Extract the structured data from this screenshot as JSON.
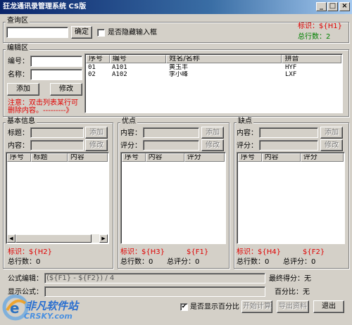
{
  "window": {
    "title": "狂龙通讯录管理系统 CS版",
    "btn_min": "_",
    "btn_max": "□",
    "btn_close": "×"
  },
  "query": {
    "group_label": "查询区",
    "input_value": "",
    "confirm_label": "确定",
    "hide_checkbox_label": "是否隐藏输入框",
    "hide_checked": false,
    "tag": "标识：${H1}",
    "count": "总行数：2"
  },
  "edit": {
    "group_label": "编辑区",
    "code_label": "编号：",
    "name_label": "名称：",
    "code_value": "",
    "name_value": "",
    "add_label": "添加",
    "modify_label": "修改",
    "note": "注意：双击列表某行可删除内容。---------》",
    "columns": [
      "序号",
      "编号",
      "姓名/名称",
      "拼音"
    ],
    "rows": [
      [
        "01",
        "A101",
        "黄玉丰",
        "HYF"
      ],
      [
        "02",
        "A102",
        "李小峰",
        "LXF"
      ]
    ]
  },
  "basic": {
    "group_label": "基本信息",
    "title_label": "标题：",
    "content_label": "内容：",
    "add_label": "添加",
    "modify_label": "修改",
    "columns": [
      "序号",
      "标题",
      "内容"
    ],
    "tag": "标识：${H2}",
    "count": "总行数：0"
  },
  "pros": {
    "group_label": "优点",
    "content_label": "内容：",
    "score_label": "评分：",
    "add_label": "添加",
    "modify_label": "修改",
    "columns": [
      "序号",
      "内容",
      "评分"
    ],
    "tag": "标识：${H3}",
    "formula_tag": "${F1}",
    "count": "总行数：0",
    "score_total": "总评分：0"
  },
  "cons": {
    "group_label": "缺点",
    "content_label": "内容：",
    "score_label": "评分：",
    "add_label": "添加",
    "modify_label": "修改",
    "columns": [
      "序号",
      "内容",
      "评分"
    ],
    "tag": "标识：${H4}",
    "formula_tag": "${F2}",
    "count": "总行数：0",
    "score_total": "总评分：0"
  },
  "footer": {
    "formula_edit_label": "公式编辑：",
    "formula_value": "(${F1} - ${F2}) / 4",
    "final_score_label": "最终得分：无",
    "show_formula_label": "显示公式：",
    "show_formula_value": "",
    "percent_label": "百分比：无",
    "show_percent_checkbox_label": "是否显示百分比",
    "show_percent_checked": true,
    "start_calc_label": "开始计算",
    "export_label": "导出资料",
    "exit_label": "退出"
  },
  "logo": {
    "main": "非凡软件站",
    "sub": "CRSKY.com"
  },
  "colors": {
    "title_start": "#0a246a",
    "title_end": "#a6caf0",
    "tag_red": "#e00000",
    "count_green": "#008000"
  }
}
